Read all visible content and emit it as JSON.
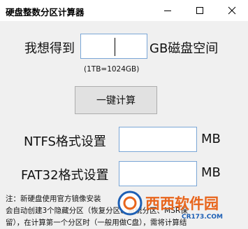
{
  "window": {
    "title": "硬盘整数分区计算器"
  },
  "input_row": {
    "prefix": "我想得到",
    "suffix": "GB磁盘空间",
    "value": "",
    "hint": "(1TB=1024GB)"
  },
  "calc_button_label": "一键计算",
  "ntfs_row": {
    "label": "NTFS格式设置",
    "value": "",
    "unit": "MB"
  },
  "fat32_row": {
    "label": "FAT32格式设置",
    "value": "",
    "unit": "MB"
  },
  "note": {
    "line1": "注：新硬盘使用官方镜像安装",
    "line2": "会自动创建3个隐藏分区（恢复分区、系统分区、MSR保",
    "line3": "留），在计算第一个分区时（一般用做C盘），需将计算结"
  },
  "watermark": {
    "site": "西西软件园",
    "domain": "CR173.COM"
  },
  "colors": {
    "accent_border": "#7aa6d6",
    "watermark_orange": "#e8651c",
    "watermark_blue": "#1d5fb4"
  }
}
